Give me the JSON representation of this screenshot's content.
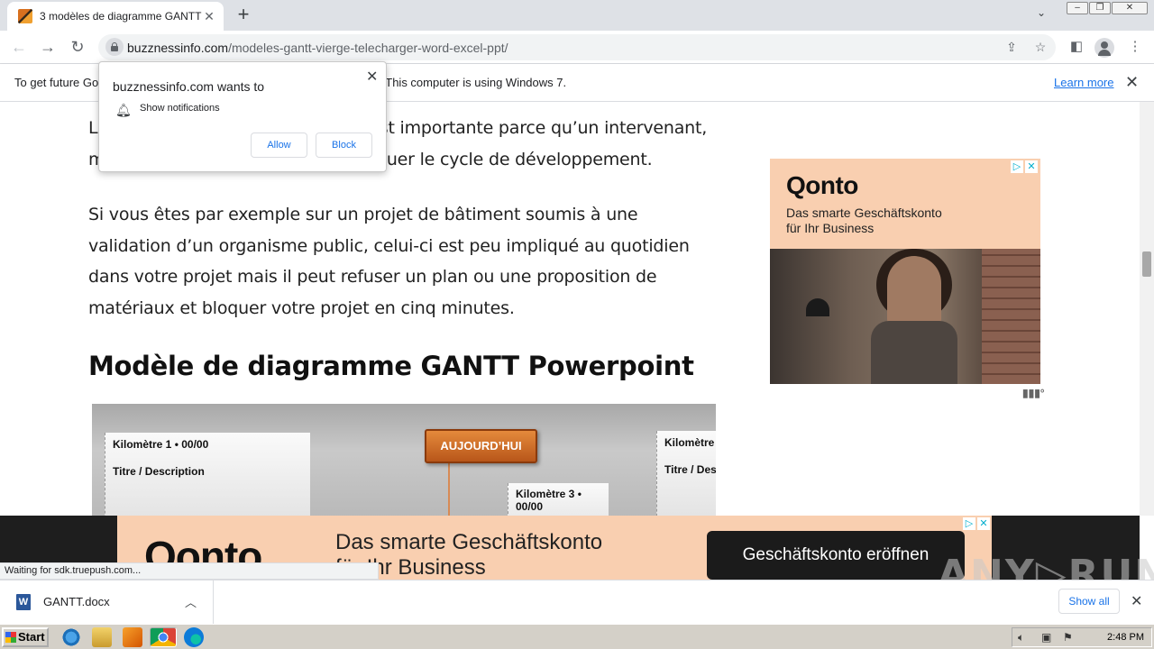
{
  "browser": {
    "tab_title": "3 modèles de diagramme GANTT vierges",
    "tab_close": "✕",
    "new_tab": "+",
    "url_domain": "buzznessinfo.com",
    "url_path": "/modeles-gantt-vierge-telecharger-word-excel-ppt/"
  },
  "infobar": {
    "message": "To get future Google Chrome updates, you'll need Windows 10 or later. This computer is using Windows 7.",
    "learn_more": "Learn more"
  },
  "notification": {
    "title": "buzznessinfo.com wants to",
    "permission": "Show notifications",
    "allow": "Allow",
    "block": "Block"
  },
  "article": {
    "para1_line1": "La gestion des parties prenantes est importante parce qu’un intervenant,",
    "para1_line2": "même le moins impliqué, peut bloquer le cycle de développement.",
    "para2": "Si vous êtes par exemple sur un projet de bâtiment soumis à une validation d’un organisme public, celui-ci est peu impliqué au quotidien dans votre projet mais il peut refuser un plan ou une proposition de matériaux et bloquer votre projet en cinq minutes.",
    "heading": "Modèle de diagramme GANTT Powerpoint"
  },
  "gantt_image": {
    "card1_line1": "Kilomètre 1 • 00/00",
    "card1_line2": "Titre / Description",
    "today": "AUJOURD’HUI",
    "card3_line1": "Kilomètre 3 •",
    "card3_line2": "00/00",
    "card4_line1": "Kilomètre",
    "card4_line2": "Titre / Des"
  },
  "side_ad": {
    "logo": "Qonto",
    "tagline_1": "Das smarte Geschäftskonto",
    "tagline_2": "für Ihr Business"
  },
  "bottom_ad": {
    "logo": "Qonto",
    "tagline_1": "Das smarte Geschäftskonto",
    "tagline_2": "für Ihr Business",
    "cta": "Geschäftskonto eröffnen"
  },
  "status": {
    "text": "Waiting for sdk.truepush.com..."
  },
  "watermark": "ANY▷RUN",
  "downloads": {
    "file_name": "GANTT.docx",
    "show_all": "Show all"
  },
  "taskbar": {
    "start": "Start",
    "clock": "2:48 PM"
  },
  "colors": {
    "ad_bg": "#f9cfb0",
    "link_blue": "#1a73e8",
    "today_orange": "#d2691e"
  }
}
